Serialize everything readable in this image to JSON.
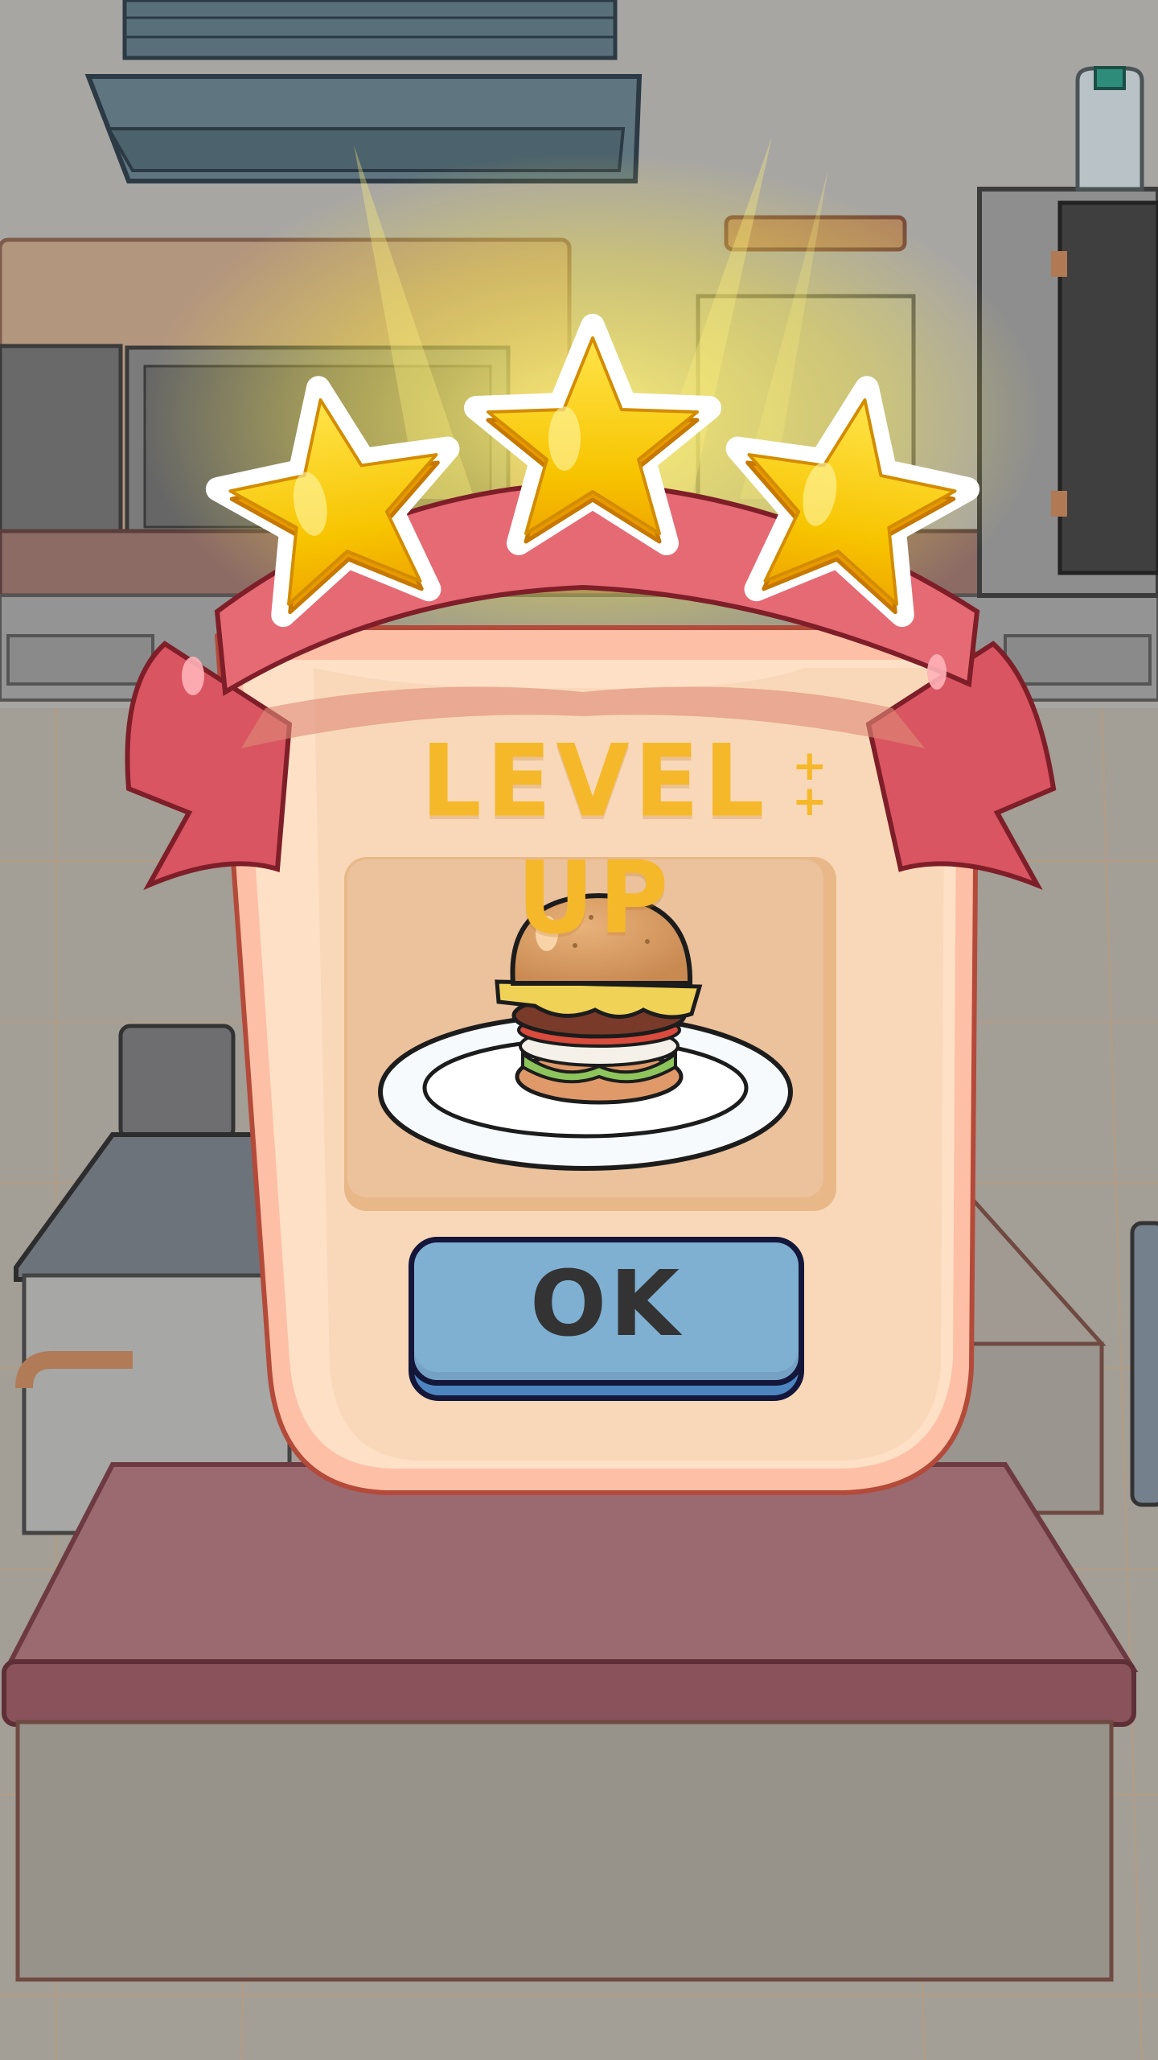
{
  "popup": {
    "title": "LEVEL UP",
    "title_decoration": "+\n+",
    "reward_item": "burger-icon",
    "ok_label": "OK"
  },
  "stars": {
    "earned": 3,
    "total": 3
  },
  "colors": {
    "title": "#f5b82a",
    "ribbon": "#d95561",
    "card": "#f8d8b8",
    "star": "#f7c400",
    "button": "#7fb0d2",
    "button_text": "#333333",
    "table_top": "#9a6a70"
  }
}
